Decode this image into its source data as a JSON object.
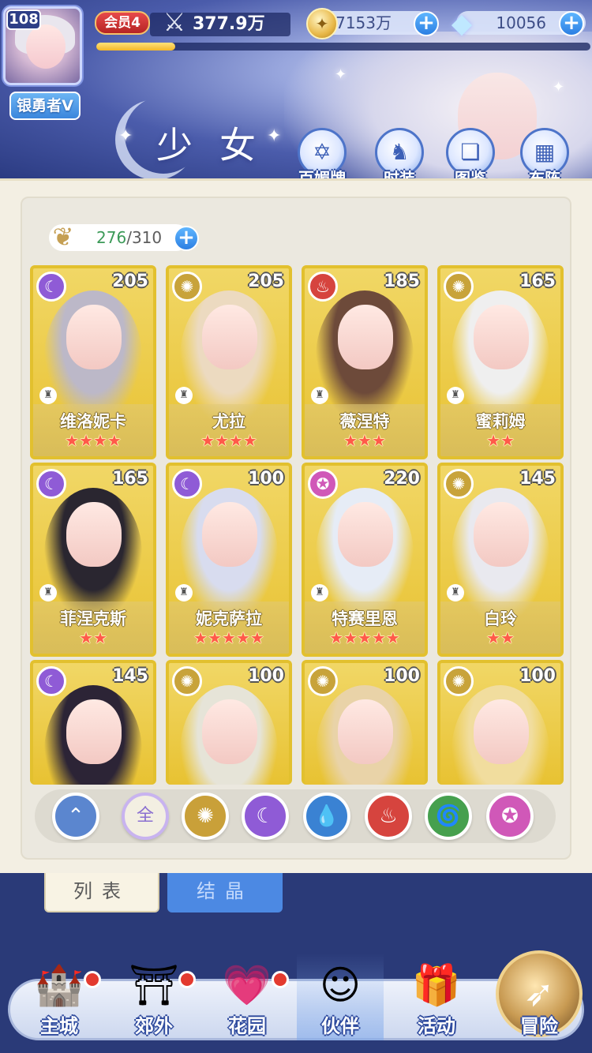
{
  "header": {
    "page_title": "少女",
    "player_level": "108",
    "player_title": "银勇者V",
    "vip_label": "会员4",
    "power": "377.9万",
    "exp_progress": 0.16,
    "gold": "7153万",
    "gems": "10056"
  },
  "features": [
    {
      "label": "百媚牌",
      "icon": "card-deck-icon"
    },
    {
      "label": "时装",
      "icon": "costume-icon"
    },
    {
      "label": "图鉴",
      "icon": "book-icon"
    },
    {
      "label": "布阵",
      "icon": "grid-icon"
    }
  ],
  "roster": {
    "current": "276",
    "max": "310"
  },
  "cards": [
    {
      "name": "维洛妮卡",
      "level": "205",
      "stars": "★★★★",
      "element": "moon",
      "color": "#8f5bd6",
      "hair": "#bcb8c8"
    },
    {
      "name": "尤拉",
      "level": "205",
      "stars": "★★★★",
      "element": "sun",
      "color": "#c8a33a",
      "hair": "#ecdac0"
    },
    {
      "name": "薇涅特",
      "level": "185",
      "stars": "★★★",
      "element": "fire",
      "color": "#d6443e",
      "hair": "#6d4a3a"
    },
    {
      "name": "蜜莉姆",
      "level": "165",
      "stars": "★★",
      "element": "sun",
      "color": "#c8a33a",
      "hair": "#efefef"
    },
    {
      "name": "菲涅克斯",
      "level": "165",
      "stars": "★★",
      "element": "moon",
      "color": "#8f5bd6",
      "hair": "#2a2630"
    },
    {
      "name": "妮克萨拉",
      "level": "100",
      "stars": "★★★★★",
      "element": "moon",
      "color": "#8f5bd6",
      "hair": "#d8dcef"
    },
    {
      "name": "特赛里恩",
      "level": "220",
      "stars": "★★★★★",
      "element": "star",
      "color": "#d058b8",
      "hair": "#e6ecf6"
    },
    {
      "name": "白玲",
      "level": "145",
      "stars": "★★",
      "element": "sun",
      "color": "#c8a33a",
      "hair": "#e9e9ef"
    },
    {
      "name": "",
      "level": "145",
      "stars": "",
      "element": "moon",
      "color": "#8f5bd6",
      "hair": "#2c2436"
    },
    {
      "name": "",
      "level": "100",
      "stars": "",
      "element": "sun",
      "color": "#c8a33a",
      "hair": "#e6e4d8"
    },
    {
      "name": "",
      "level": "100",
      "stars": "",
      "element": "sun",
      "color": "#c8a33a",
      "hair": "#e9d3a8"
    },
    {
      "name": "",
      "level": "100",
      "stars": "",
      "element": "sun",
      "color": "#c8a33a",
      "hair": "#f1dd9e"
    }
  ],
  "filters": [
    {
      "label": "",
      "icon": "wind-arrow-icon",
      "color": "#5b86cf"
    },
    {
      "label": "全",
      "icon": "all-icon",
      "color": "#f3efe2",
      "text_color": "#8a6fd0"
    },
    {
      "label": "",
      "icon": "sun-icon",
      "color": "#c9a039"
    },
    {
      "label": "",
      "icon": "moon-icon",
      "color": "#8f5bd6"
    },
    {
      "label": "",
      "icon": "water-icon",
      "color": "#3a82d3"
    },
    {
      "label": "",
      "icon": "fire-icon",
      "color": "#d6443e"
    },
    {
      "label": "",
      "icon": "tornado-icon",
      "color": "#46a04e"
    },
    {
      "label": "",
      "icon": "star-orb-icon",
      "color": "#d058b8"
    }
  ],
  "subtabs": {
    "list": "列表",
    "crystal": "结晶"
  },
  "nav": [
    {
      "label": "主城",
      "icon": "castle-icon",
      "dot": true
    },
    {
      "label": "郊外",
      "icon": "gate-icon",
      "dot": true
    },
    {
      "label": "花园",
      "icon": "heart-icon",
      "dot": true
    },
    {
      "label": "伙伴",
      "icon": "partner-icon",
      "dot": false
    },
    {
      "label": "活动",
      "icon": "gift-icon",
      "dot": false
    },
    {
      "label": "冒险",
      "icon": "compass-icon",
      "dot": false
    }
  ]
}
